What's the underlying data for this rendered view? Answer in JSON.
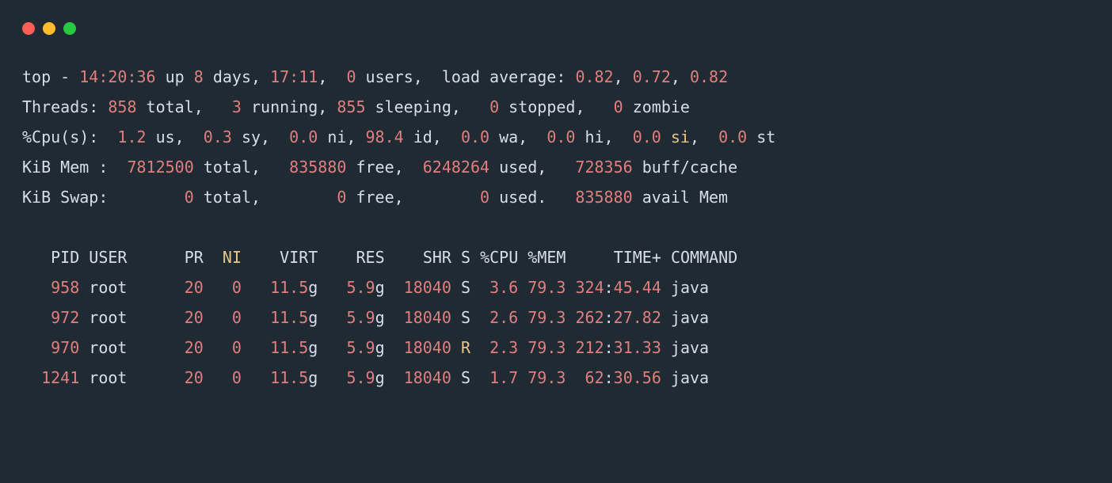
{
  "summary": {
    "time": "14:20:36",
    "uptime_days": "8",
    "uptime_hm": "17:11",
    "users": "0",
    "load1": "0.82",
    "load2": "0.72",
    "load3": "0.82"
  },
  "threads": {
    "total": "858",
    "running": "3",
    "sleeping": "855",
    "stopped": "0",
    "zombie": "0"
  },
  "cpu": {
    "us": "1.2",
    "sy": "0.3",
    "ni": "0.0",
    "id": "98.4",
    "wa": "0.0",
    "hi": "0.0",
    "si_val": "0.0",
    "si_lbl": "si",
    "st": "0.0"
  },
  "mem": {
    "total": "7812500",
    "free": "835880",
    "used": "6248264",
    "buffcache": "728356"
  },
  "swap": {
    "total": "0",
    "free": "0",
    "used": "0",
    "avail": "835880"
  },
  "cols": {
    "pid": "PID",
    "user": "USER",
    "pr": "PR",
    "ni": "NI",
    "virt": "VIRT",
    "res": "RES",
    "shr": "SHR",
    "s": "S",
    "cpu": "%CPU",
    "mem": "%MEM",
    "time": "TIME+",
    "cmd": "COMMAND"
  },
  "rows": [
    {
      "pid": "958",
      "user": "root",
      "pr": "20",
      "ni": "0",
      "virt": "11.5",
      "res": "5.9",
      "shr": "18040",
      "s": "S",
      "cpu": "3.6",
      "mem": "79.3",
      "t1": "324",
      "t2": "45.44",
      "cmd": "java"
    },
    {
      "pid": "972",
      "user": "root",
      "pr": "20",
      "ni": "0",
      "virt": "11.5",
      "res": "5.9",
      "shr": "18040",
      "s": "S",
      "cpu": "2.6",
      "mem": "79.3",
      "t1": "262",
      "t2": "27.82",
      "cmd": "java"
    },
    {
      "pid": "970",
      "user": "root",
      "pr": "20",
      "ni": "0",
      "virt": "11.5",
      "res": "5.9",
      "shr": "18040",
      "s": "R",
      "cpu": "2.3",
      "mem": "79.3",
      "t1": "212",
      "t2": "31.33",
      "cmd": "java"
    },
    {
      "pid": "1241",
      "user": "root",
      "pr": "20",
      "ni": "0",
      "virt": "11.5",
      "res": "5.9",
      "shr": "18040",
      "s": "S",
      "cpu": "1.7",
      "mem": "79.3",
      "t1": "62",
      "t2": "30.56",
      "cmd": "java"
    }
  ]
}
